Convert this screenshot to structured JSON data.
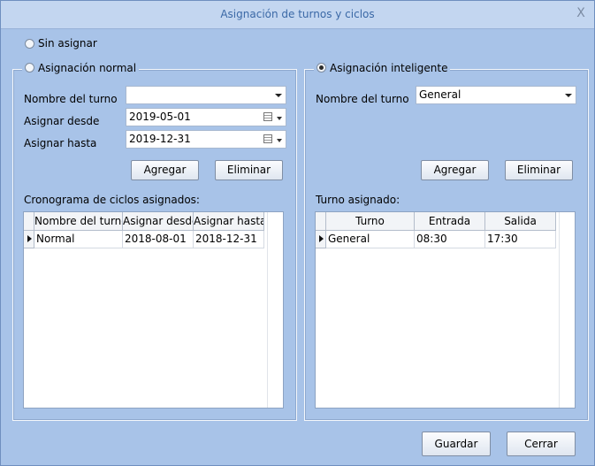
{
  "window": {
    "title": "Asignación de turnos y ciclos",
    "close_glyph": "X"
  },
  "options": {
    "sin_asignar": "Sin asignar",
    "normal": "Asignación normal",
    "inteligente": "Asignación inteligente",
    "selected": "inteligente"
  },
  "normal": {
    "turno_label": "Nombre del turno",
    "turno_value": "",
    "desde_label": "Asignar desde",
    "desde_value": "2019-05-01",
    "hasta_label": "Asignar hasta",
    "hasta_value": "2019-12-31",
    "agregar": "Agregar",
    "eliminar": "Eliminar",
    "grid_title": "Cronograma de ciclos asignados:",
    "columns": [
      "Nombre del turno",
      "Asignar desde",
      "Asignar hasta"
    ],
    "rows": [
      [
        "Normal",
        "2018-08-01",
        "2018-12-31"
      ]
    ]
  },
  "inteligente": {
    "turno_label": "Nombre del turno",
    "turno_value": "General",
    "agregar": "Agregar",
    "eliminar": "Eliminar",
    "grid_title": "Turno asignado:",
    "columns": [
      "Turno",
      "Entrada",
      "Salida"
    ],
    "rows": [
      [
        "General",
        "08:30",
        "17:30"
      ]
    ]
  },
  "footer": {
    "guardar": "Guardar",
    "cerrar": "Cerrar"
  }
}
